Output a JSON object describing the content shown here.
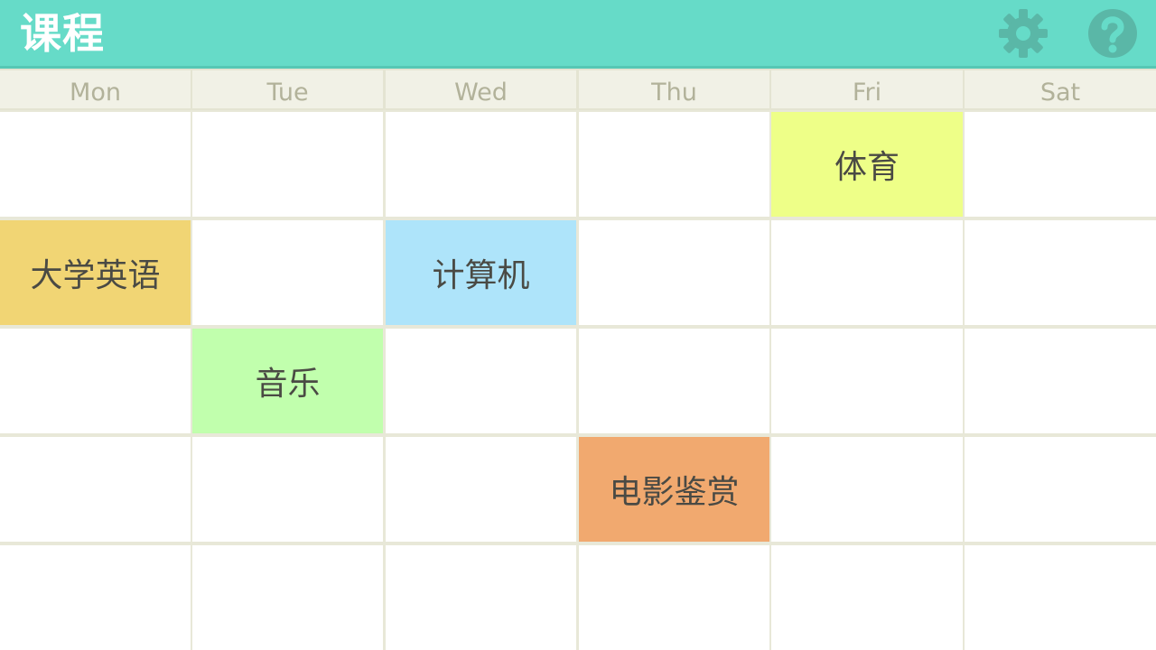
{
  "app": {
    "title": "课程",
    "settings_icon": "gear-icon",
    "help_icon": "help-icon",
    "accent_color": "#66dbc8",
    "icon_color": "#5ab7a7"
  },
  "days": [
    "Mon",
    "Tue",
    "Wed",
    "Thu",
    "Fri",
    "Sat"
  ],
  "periods": 5,
  "courses": [
    {
      "name": "体育",
      "day": 4,
      "period": 0,
      "color": "#eeff88"
    },
    {
      "name": "大学英语",
      "day": 0,
      "period": 1,
      "color": "#f1d574"
    },
    {
      "name": "计算机",
      "day": 2,
      "period": 1,
      "color": "#aee4fa"
    },
    {
      "name": "音乐",
      "day": 1,
      "period": 2,
      "color": "#c1ffad"
    },
    {
      "name": "电影鉴赏",
      "day": 3,
      "period": 3,
      "color": "#f1a96f"
    }
  ]
}
